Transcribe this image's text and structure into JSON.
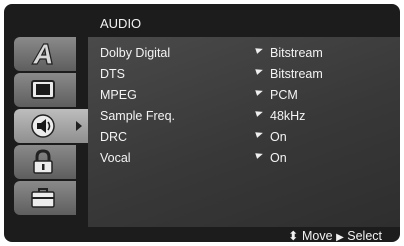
{
  "menu": {
    "title": "AUDIO",
    "tabs": [
      {
        "name": "language",
        "icon": "letter-a-icon",
        "active": false
      },
      {
        "name": "display",
        "icon": "tv-screen-icon",
        "active": false
      },
      {
        "name": "audio",
        "icon": "speaker-icon",
        "active": true
      },
      {
        "name": "lock",
        "icon": "padlock-icon",
        "active": false
      },
      {
        "name": "others",
        "icon": "briefcase-icon",
        "active": false
      }
    ],
    "items": [
      {
        "label": "Dolby Digital",
        "value": "Bitstream"
      },
      {
        "label": "DTS",
        "value": "Bitstream"
      },
      {
        "label": "MPEG",
        "value": "PCM"
      },
      {
        "label": "Sample Freq.",
        "value": "48kHz"
      },
      {
        "label": "DRC",
        "value": "On"
      },
      {
        "label": "Vocal",
        "value": "On"
      }
    ]
  },
  "footer": {
    "move": "Move",
    "select": "Select"
  }
}
